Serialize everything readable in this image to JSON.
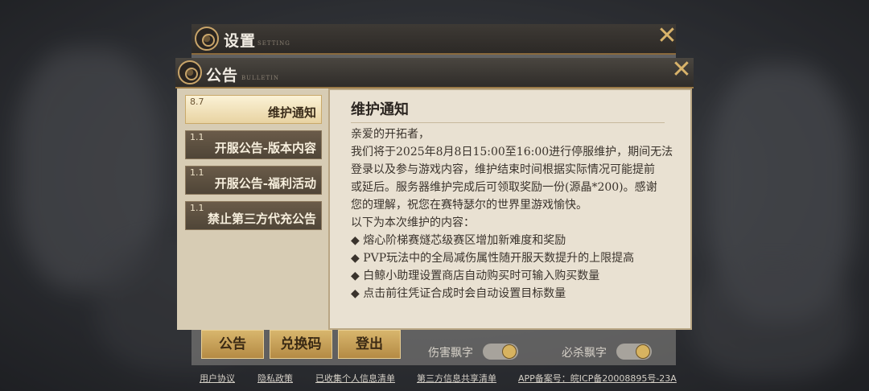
{
  "settings": {
    "title": "设置",
    "subtitle": "SETTING",
    "bottom_buttons": [
      "公告",
      "兑换码",
      "登出"
    ],
    "toggles": [
      {
        "label": "伤害飘字",
        "on": true
      },
      {
        "label": "必杀飘字",
        "on": true
      }
    ]
  },
  "footer_links": [
    "用户协议",
    "隐私政策",
    "已收集个人信息清单",
    "第三方信息共享清单",
    "APP备案号：皖ICP备20008895号-23A"
  ],
  "bulletin": {
    "title": "公告",
    "subtitle": "BULLETIN",
    "items": [
      {
        "date": "8.7",
        "title": "维护通知",
        "active": true
      },
      {
        "date": "1.1",
        "title": "开服公告-版本内容",
        "active": false
      },
      {
        "date": "1.1",
        "title": "开服公告-福利活动",
        "active": false
      },
      {
        "date": "1.1",
        "title": "禁止第三方代充公告",
        "active": false
      }
    ],
    "content": {
      "title": "维护通知",
      "lines": [
        "亲爱的开拓者，",
        "我们将于2025年8月8日15:00至16:00进行停服维护，期间无法",
        "登录以及参与游戏内容，维护结束时间根据实际情况可能提前",
        "或延后。服务器维护完成后可领取奖励一份(源晶*200)。感谢",
        "您的理解，祝您在赛特瑟尔的世界里游戏愉快。",
        "以下为本次维护的内容：",
        "◆ 熔心阶梯赛燧芯级赛区增加新难度和奖励",
        "◆ PVP玩法中的全局减伤属性随开服天数提升的上限提高",
        "◆ 白鲸小助理设置商店自动购买时可输入购买数量",
        "◆ 点击前往凭证合成时会自动设置目标数量"
      ]
    }
  },
  "colors": {
    "accent_gold": "#d9b36a",
    "panel_cream": "#e9e1d2"
  }
}
